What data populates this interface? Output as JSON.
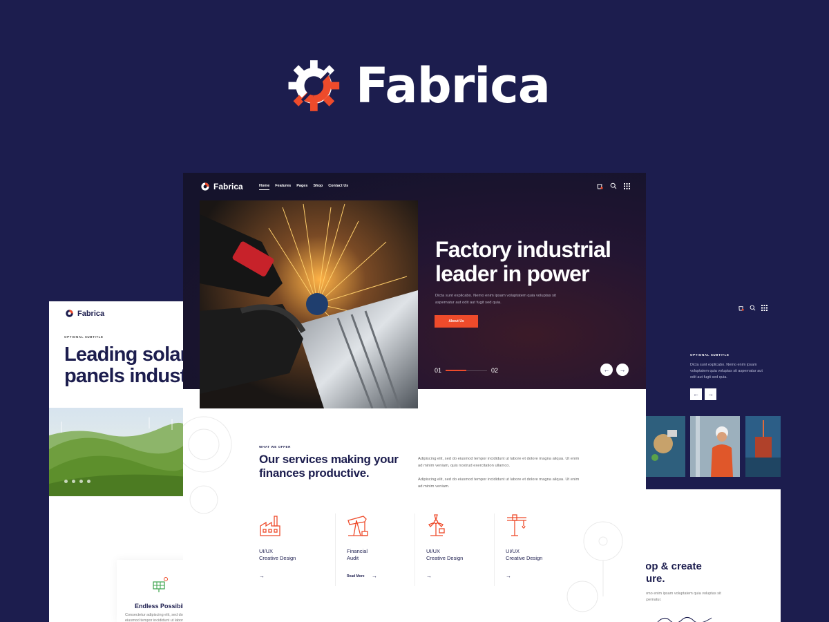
{
  "brand": {
    "name": "Fabrica",
    "colors": {
      "background": "#1c1d4e",
      "accent": "#ee4b2b",
      "text": "#ffffff"
    },
    "logo_icon": "gear-slash-logo"
  },
  "left_card": {
    "logo_name": "Fabrica",
    "subtitle": "OPTIONAL SUBTITLE",
    "title": "Leading solar\npanels industry",
    "social_icons": [
      "facebook-icon",
      "twitter-icon",
      "instagram-icon",
      "pinterest-icon"
    ],
    "feature": {
      "icon": "solar-panel-icon",
      "title": "Endless Possibilities",
      "text": "Consectetur adipiscing elit, sed do\neiusmod tempor incididunt ut labore"
    }
  },
  "main_card": {
    "nav": {
      "logo_name": "Fabrica",
      "menu": [
        {
          "label": "Home",
          "active": true
        },
        {
          "label": "Features",
          "active": false
        },
        {
          "label": "Pages",
          "active": false
        },
        {
          "label": "Shop",
          "active": false
        },
        {
          "label": "Contact Us",
          "active": false
        }
      ],
      "icons": [
        "cart-icon",
        "search-icon",
        "grid-menu-icon"
      ]
    },
    "hero": {
      "title": "Factory industrial\nleader in power",
      "text": "Dicta sunt explicabo. Nemo enim ipsam voluptatem quia voluptas sit aspernatur aut odit aut fugit sed quia.",
      "button": "About Us",
      "slide_current": "01",
      "slide_next": "02",
      "slide_progress": 0.5,
      "prev_arrow": "←",
      "next_arrow": "→"
    },
    "services": {
      "eyebrow": "WHAT WE OFFER",
      "title": "Our services making your\nfinances productive.",
      "paragraphs": [
        "Adipiscing elit, sed do eiusmod tempor incididunt ut labore et dolore magna aliqua. Ut enim ad minim veniam, quis nostrud exercitation ullamco.",
        "Adipiscing elit, sed do eiusmod tempor incididunt ut labore et dolore magna aliqua. Ut enim ad minim veniam."
      ],
      "items": [
        {
          "icon": "factory-icon",
          "label": "UI/UX\nCreative Design",
          "link": ""
        },
        {
          "icon": "oil-pump-icon",
          "label": "Financial\nAudit",
          "link": "Read More"
        },
        {
          "icon": "wind-turbine-icon",
          "label": "UI/UX\nCreative Design",
          "link": ""
        },
        {
          "icon": "crane-icon",
          "label": "UI/UX\nCreative Design",
          "link": ""
        }
      ],
      "arrow": "→"
    }
  },
  "right_card": {
    "icons": [
      "cart-icon",
      "search-icon",
      "grid-menu-icon"
    ],
    "subtitle": "OPTIONAL SUBTITLE",
    "text": "Dicta sunt explicabo. Nemo enim ipsam voluptatem quia voluptas sit aspernatur aut odit aut fugit sed quia.",
    "prev_arrow": "←",
    "next_arrow": "→",
    "title": "lop & create\nture.",
    "body": "Nemo enim ipsam voluptatem quia voluptas sit aspernatur."
  }
}
